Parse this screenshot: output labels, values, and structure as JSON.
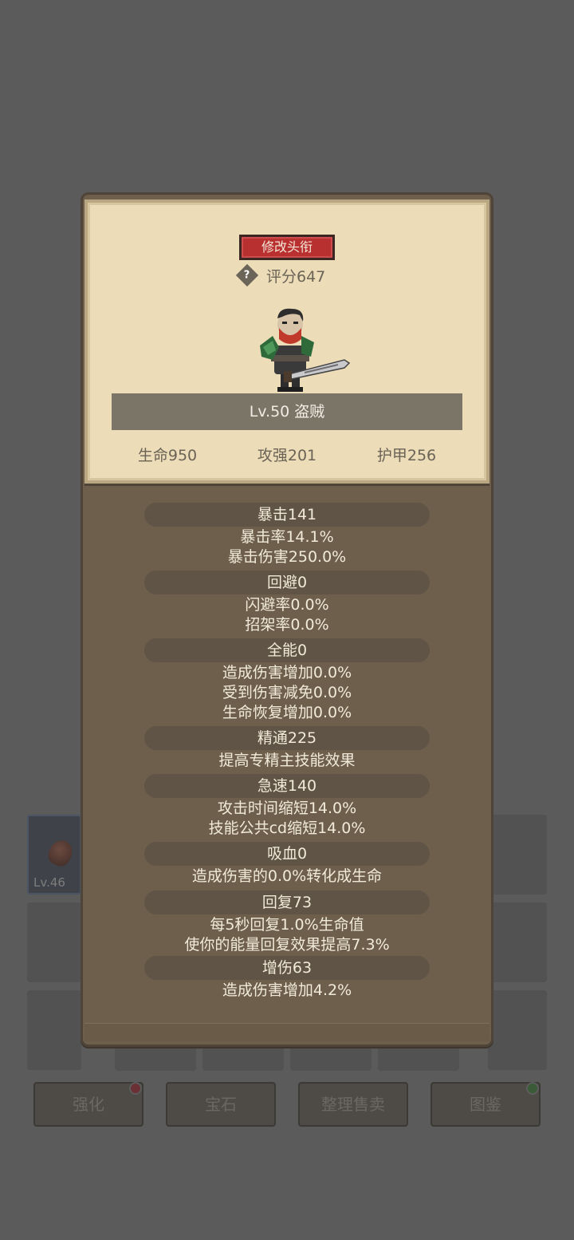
{
  "background": {
    "inventory_item_level": "Lv.46",
    "buttons": [
      "强化",
      "宝石",
      "整理售卖",
      "图鉴"
    ]
  },
  "popup": {
    "title_button": "修改头衔",
    "help_icon": "question-mark",
    "score": "评分647",
    "level_class": "Lv.50 盗贼",
    "base_stats": {
      "hp": "生命950",
      "attack": "攻强201",
      "armor": "护甲256"
    },
    "stat_groups": [
      {
        "header": "暴击141",
        "lines": [
          "暴击率14.1%",
          "暴击伤害250.0%"
        ]
      },
      {
        "header": "回避0",
        "lines": [
          "闪避率0.0%",
          "招架率0.0%"
        ]
      },
      {
        "header": "全能0",
        "lines": [
          "造成伤害增加0.0%",
          "受到伤害减免0.0%",
          "生命恢复增加0.0%"
        ]
      },
      {
        "header": "精通225",
        "lines": [
          "提高专精主技能效果"
        ]
      },
      {
        "header": "急速140",
        "lines": [
          "攻击时间缩短14.0%",
          "技能公共cd缩短14.0%"
        ]
      },
      {
        "header": "吸血0",
        "lines": [
          "造成伤害的0.0%转化成生命"
        ]
      },
      {
        "header": "回复73",
        "lines": [
          "每5秒回复1.0%生命值",
          "使你的能量回复效果提高7.3%"
        ]
      },
      {
        "header": "增伤63",
        "lines": [
          "造成伤害增加4.2%"
        ]
      }
    ]
  },
  "colors": {
    "title_button": "#b93030",
    "card": "#ecdcb8",
    "panel": "#6e5f4c",
    "dot_red": "#b0333b",
    "dot_green": "#3f7e3c"
  }
}
